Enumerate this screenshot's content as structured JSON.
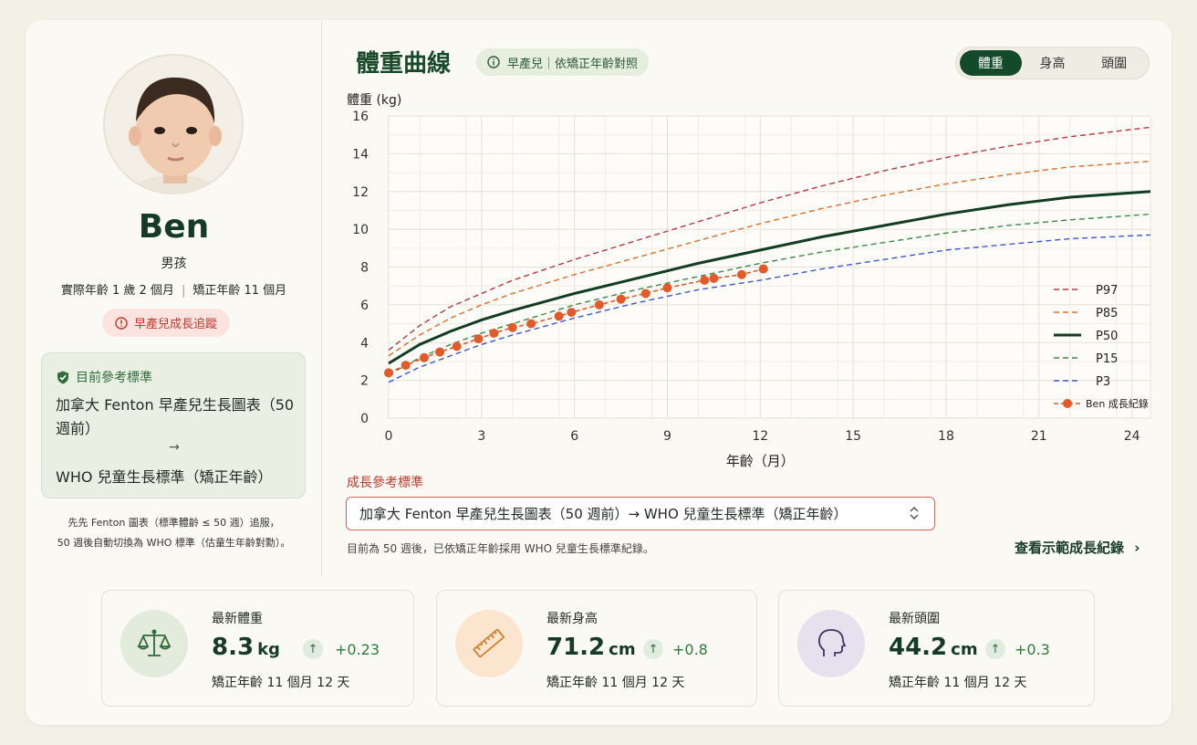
{
  "profile": {
    "name": "Ben",
    "gender": "男孩",
    "actual_age": "實際年齡 1 歲 2 個月",
    "corrected_age": "矯正年齡 11 個月",
    "tracking_badge": "早產兒成長追蹤"
  },
  "reference_box": {
    "title": "目前參考標準",
    "line1": "加拿大 Fenton 早產兒生長圖表（50 週前）",
    "arrow": "→",
    "line2": "WHO 兒童生長標準（矯正年齡）"
  },
  "sidebar_note": {
    "line1": "先先 Fenton 圖表（標準體齡 ≤ 50 週）追服，",
    "line2": "50 週後自動切換為 WHO 標準（估童生年齡對勳）。"
  },
  "header": {
    "title": "體重曲線",
    "chip": "早產兒｜依矯正年齡對照",
    "tabs": [
      "體重",
      "身高",
      "頭圍"
    ],
    "active_tab": "體重"
  },
  "chart_data": {
    "type": "line",
    "ylabel": "體重 (kg)",
    "xlabel": "年齡（月）",
    "xlim": [
      0,
      24.6
    ],
    "ylim": [
      0,
      16
    ],
    "xticks": [
      0,
      3,
      6,
      9,
      12,
      15,
      18,
      21,
      24
    ],
    "yticks": [
      0,
      2,
      4,
      6,
      8,
      10,
      12,
      14,
      16
    ],
    "grid": true,
    "legend_position": "bottom-right",
    "percentile_x": [
      0,
      1,
      2,
      3,
      4,
      6,
      8,
      10,
      12,
      14,
      16,
      18,
      20,
      22,
      24.6
    ],
    "percentiles": [
      {
        "name": "P97",
        "color": "#b8373f",
        "dash": true,
        "values": [
          3.6,
          4.9,
          5.9,
          6.6,
          7.3,
          8.4,
          9.4,
          10.4,
          11.4,
          12.3,
          13.1,
          13.8,
          14.4,
          14.9,
          15.4
        ]
      },
      {
        "name": "P85",
        "color": "#d9702c",
        "dash": true,
        "values": [
          3.3,
          4.4,
          5.3,
          6.0,
          6.6,
          7.6,
          8.5,
          9.4,
          10.3,
          11.1,
          11.8,
          12.4,
          12.9,
          13.3,
          13.6
        ]
      },
      {
        "name": "P50",
        "color": "#123d22",
        "dash": false,
        "values": [
          2.9,
          3.9,
          4.6,
          5.2,
          5.7,
          6.6,
          7.4,
          8.2,
          8.9,
          9.6,
          10.2,
          10.8,
          11.3,
          11.7,
          12.0
        ]
      },
      {
        "name": "P15",
        "color": "#3a8a4a",
        "dash": true,
        "values": [
          2.3,
          3.2,
          3.9,
          4.5,
          5.0,
          6.0,
          6.8,
          7.5,
          8.2,
          8.8,
          9.3,
          9.8,
          10.2,
          10.5,
          10.8
        ]
      },
      {
        "name": "P3",
        "color": "#3e57cc",
        "dash": true,
        "values": [
          1.9,
          2.7,
          3.3,
          3.9,
          4.4,
          5.3,
          6.1,
          6.8,
          7.3,
          7.9,
          8.4,
          8.9,
          9.2,
          9.5,
          9.7
        ]
      }
    ],
    "ben": {
      "name": "Ben 成長紀錄",
      "color": "#e2592a",
      "x": [
        0,
        0.55,
        1.15,
        1.65,
        2.2,
        2.9,
        3.4,
        4.0,
        4.6,
        5.5,
        5.9,
        6.8,
        7.5,
        8.3,
        9.0,
        10.2,
        10.5,
        11.4,
        12.1
      ],
      "y": [
        2.4,
        2.8,
        3.2,
        3.5,
        3.8,
        4.2,
        4.5,
        4.8,
        5.0,
        5.4,
        5.6,
        6.0,
        6.3,
        6.6,
        6.9,
        7.3,
        7.4,
        7.6,
        7.9
      ]
    }
  },
  "reference_select": {
    "label": "成長參考標準",
    "value": "加拿大 Fenton 早產兒生長圖表（50 週前）→ WHO 兒童生長標準（矯正年齡）",
    "caret": "⌃⌄"
  },
  "footer": {
    "note": "目前為 50 週後，已依矯正年齡採用 WHO 兒童生長標準紀錄。",
    "link": "查看示範成長紀錄"
  },
  "stats": [
    {
      "label": "最新體重",
      "value": "8.3",
      "unit": "kg",
      "delta": "+0.23",
      "sub": "矯正年齡 11 個月 12 天",
      "icon": "scale-icon",
      "bg": "#e2ebdc",
      "color": "#2f6b3b"
    },
    {
      "label": "最新身高",
      "value": "71.2",
      "unit": "cm",
      "delta": "+0.8",
      "sub": "矯正年齡 11 個月 12 天",
      "icon": "ruler-icon",
      "bg": "#fbe5cf",
      "color": "#d5822e"
    },
    {
      "label": "最新頭圍",
      "value": "44.2",
      "unit": "cm",
      "delta": "+0.3",
      "sub": "矯正年齡 11 個月 12 天",
      "icon": "head-icon",
      "bg": "#e7e1ef",
      "color": "#3d3560"
    }
  ]
}
